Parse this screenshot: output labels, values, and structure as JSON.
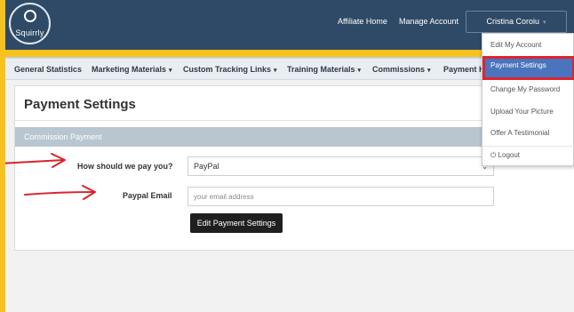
{
  "header": {
    "logo_text": "Squirrly",
    "links": [
      {
        "label": "Affiliate Home"
      },
      {
        "label": "Manage Account"
      }
    ],
    "user": {
      "name": "Cristina Coroiu",
      "caret": "▾"
    }
  },
  "nav": {
    "items": [
      {
        "label": "General Statistics",
        "has_caret": false
      },
      {
        "label": "Marketing Materials",
        "has_caret": true
      },
      {
        "label": "Custom Tracking Links",
        "has_caret": true
      },
      {
        "label": "Training Materials",
        "has_caret": true
      },
      {
        "label": "Commissions",
        "has_caret": true
      },
      {
        "label": "Payment H",
        "has_caret": false
      }
    ],
    "caret": "▾"
  },
  "main": {
    "title": "Payment Settings",
    "panel_title": "Commission Payment",
    "pay_method_label": "How should we pay you?",
    "pay_method_value": "PayPal",
    "email_label": "Paypal Email",
    "email_placeholder": "your email address",
    "submit_label": "Edit Payment Settings"
  },
  "user_menu": {
    "items": [
      {
        "label": "Edit My Account"
      },
      {
        "label": "Payment Settings",
        "active": true
      },
      {
        "label": "Change My Password"
      },
      {
        "label": "Upload Your Picture"
      },
      {
        "label": "Offer A Testimonial"
      },
      {
        "label": "Logout",
        "icon": "power-icon"
      }
    ]
  },
  "colors": {
    "header_bg": "#2f4a66",
    "frame_border": "#f7c21d",
    "active_item": "#4a74bd",
    "highlight_border": "#e0242e",
    "annotation_arrow": "#d9242b"
  }
}
